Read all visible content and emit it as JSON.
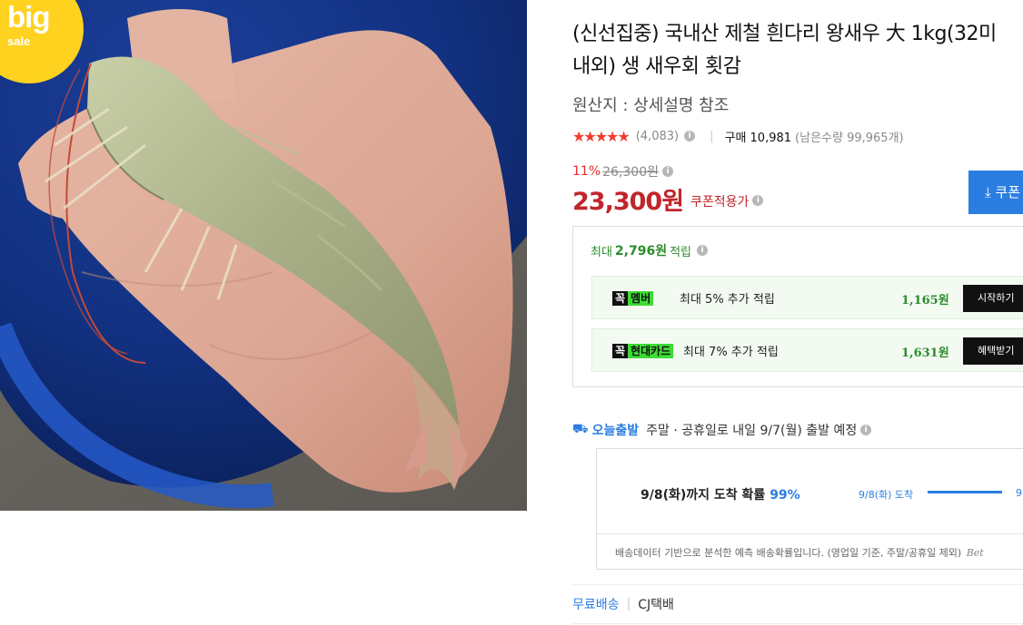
{
  "badge": {
    "big": "big",
    "sale": "sale"
  },
  "product": {
    "title": "(신선집중) 국내산 제철 흰다리 왕새우 大 1kg(32미 내외) 생 새우회 횟감",
    "origin": "원산지 : 상세설명 참조",
    "stars": "★★★★★",
    "review_count": "(4,083)",
    "purchase": "구매 10,981",
    "remaining": "(남은수량 99,965개)"
  },
  "price": {
    "discount_pct": "11%",
    "original": "26,300원",
    "final": "23,300원",
    "coupon_applied": "쿠폰적용가",
    "coupon_button": "쿠폰"
  },
  "rewards": {
    "prefix": "최대",
    "amount": "2,796원",
    "suffix": "적립",
    "rows": [
      {
        "tag_k": "꼭",
        "tag_name": "멤버",
        "desc": "최대 5% 추가 적립",
        "amount": "1,165원",
        "action": "시작하기"
      },
      {
        "tag_k": "꼭",
        "tag_name": "현대카드",
        "desc": "최대 7% 추가 적립",
        "amount": "1,631원",
        "action": "혜택받기"
      }
    ]
  },
  "shipping": {
    "today_label": "오늘출발",
    "today_text": "주말 · 공휴일로 내일 9/7(월) 출발 예정",
    "arrival_prefix": "9/8(화)까지 도착 확률",
    "arrival_prob": "99%",
    "arrival_label": "9/8(화) 도착",
    "arrival_next": "9",
    "note": "배송데이터 기반으로 분석한 예측 배송확률입니다. (영업일 기준, 주말/공휴일 제외)",
    "note_brand": "Bet",
    "free": "무료배송",
    "carrier": "CJ택배"
  },
  "colors": {
    "price_red": "#c0262c",
    "accent_blue": "#2a7de1",
    "reward_green": "#2c8c2c",
    "badge_yellow": "#ffd21f"
  },
  "icons": {
    "info": "info-icon",
    "truck": "truck-icon",
    "download": "download-icon"
  }
}
